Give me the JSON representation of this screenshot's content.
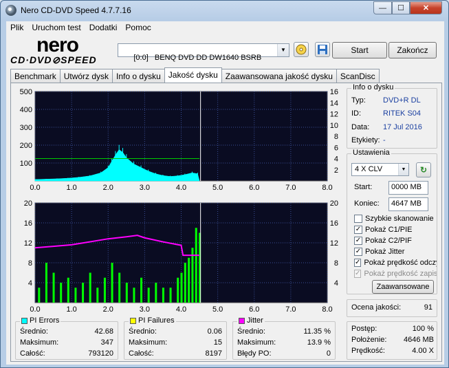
{
  "window": {
    "title": "Nero CD-DVD Speed 4.7.7.16",
    "min": "—",
    "max": "☐",
    "close": "✕"
  },
  "menu": [
    "Plik",
    "Uruchom test",
    "Dodatki",
    "Pomoc"
  ],
  "logo": {
    "top": "nero",
    "bottom": "CD·DVD⊘SPEED"
  },
  "toolbar": {
    "drive": "[0:0]   BENQ DVD DD DW1640 BSRB",
    "start": "Start",
    "exit": "Zakończ"
  },
  "tabs": [
    "Benchmark",
    "Utwórz dysk",
    "Info o dysku",
    "Jakość dysku",
    "Zaawansowana jakość dysku",
    "ScanDisc"
  ],
  "active_tab": 3,
  "disc_info": {
    "title": "Info o dysku",
    "type_label": "Typ:",
    "type": "DVD+R DL",
    "id_label": "ID:",
    "id": "RITEK S04",
    "date_label": "Data:",
    "date": "17 Jul 2016",
    "label_label": "Etykiety:",
    "label": "-"
  },
  "settings": {
    "title": "Ustawienia",
    "speed": "4 X CLV",
    "start_label": "Start:",
    "start": "0000 MB",
    "end_label": "Koniec:",
    "end": "4647 MB",
    "quick": "Szybkie skanowanie",
    "c1": "Pokaż C1/PIE",
    "c2": "Pokaż C2/PIF",
    "jitter": "Pokaż Jitter",
    "read": "Pokaż prędkość odczytu",
    "write": "Pokaż prędkość zapisu",
    "advanced": "Zaawansowane"
  },
  "quality": {
    "label": "Ocena jakości:",
    "value": "91"
  },
  "progress": {
    "progress_label": "Postęp:",
    "progress": "100 %",
    "position_label": "Położenie:",
    "position": "4646 MB",
    "speed_label": "Prędkość:",
    "speed": "4.00 X"
  },
  "pi_errors": {
    "title": "PI Errors",
    "color": "#00ffff",
    "avg_label": "Średnio:",
    "avg": "42.68",
    "max_label": "Maksimum:",
    "max": "347",
    "total_label": "Całość:",
    "total": "793120"
  },
  "pi_failures": {
    "title": "PI Failures",
    "color": "#ffff00",
    "avg_label": "Średnio:",
    "avg": "0.06",
    "max_label": "Maksimum:",
    "max": "15",
    "total_label": "Całość:",
    "total": "8197"
  },
  "jitter": {
    "title": "Jitter",
    "color": "#ff00ff",
    "avg_label": "Średnio:",
    "avg": "11.35 %",
    "max_label": "Maksimum:",
    "max": "13.9 %",
    "po_label": "Błędy PO:",
    "po": "0"
  },
  "chart_data": [
    {
      "type": "area",
      "name": "PI Errors chart",
      "xlim": [
        0,
        8
      ],
      "ylim": [
        0,
        500
      ],
      "y2lim": [
        0,
        16
      ],
      "xticks": [
        "0.0",
        "1.0",
        "2.0",
        "3.0",
        "4.0",
        "5.0",
        "6.0",
        "7.0",
        "8.0"
      ],
      "yticks": [
        "100",
        "200",
        "300",
        "400",
        "500"
      ],
      "y2ticks": [
        "2",
        "4",
        "6",
        "8",
        "10",
        "12",
        "14",
        "16"
      ],
      "series": [
        {
          "name": "PI Errors",
          "color": "#00ffff",
          "x": [
            0.0,
            0.3,
            0.6,
            0.9,
            1.2,
            1.5,
            1.8,
            2.0,
            2.1,
            2.2,
            2.3,
            2.4,
            2.5,
            2.7,
            2.9,
            3.1,
            3.3,
            3.5,
            3.7,
            3.9,
            4.1,
            4.3,
            4.45,
            4.5
          ],
          "y": [
            8,
            10,
            12,
            15,
            20,
            28,
            45,
            75,
            110,
            145,
            175,
            160,
            130,
            95,
            75,
            55,
            40,
            30,
            25,
            28,
            35,
            45,
            40,
            0
          ]
        },
        {
          "name": "Read speed",
          "color": "#00cc00",
          "x": [
            0.0,
            4.5
          ],
          "y": [
            4,
            4
          ]
        }
      ]
    },
    {
      "type": "bar",
      "name": "PI Failures chart",
      "xlim": [
        0,
        8
      ],
      "ylim": [
        0,
        20
      ],
      "y2lim": [
        0,
        20
      ],
      "xticks": [
        "0.0",
        "1.0",
        "2.0",
        "3.0",
        "4.0",
        "5.0",
        "6.0",
        "7.0",
        "8.0"
      ],
      "yticks": [
        "4",
        "8",
        "12",
        "16",
        "20"
      ],
      "y2ticks": [
        "4",
        "8",
        "12",
        "16",
        "20"
      ],
      "series": [
        {
          "name": "PI Failures",
          "color": "#00ff00",
          "x": [
            0.1,
            0.3,
            0.5,
            0.7,
            0.9,
            1.1,
            1.3,
            1.5,
            1.7,
            1.9,
            2.1,
            2.3,
            2.5,
            2.7,
            2.9,
            3.1,
            3.3,
            3.5,
            3.7,
            3.9,
            4.0,
            4.1,
            4.2,
            4.3,
            4.4,
            4.5
          ],
          "y": [
            3,
            8,
            6,
            4,
            5,
            3,
            4,
            6,
            3,
            5,
            8,
            6,
            4,
            3,
            5,
            3,
            4,
            3,
            3,
            5,
            6,
            8,
            9,
            11,
            15,
            14
          ]
        },
        {
          "name": "Jitter",
          "color": "#ff00ff",
          "x": [
            0.0,
            0.5,
            1.0,
            1.5,
            2.0,
            2.5,
            2.8,
            3.0,
            3.5,
            4.0,
            4.05,
            4.5
          ],
          "y": [
            11.0,
            11.3,
            11.6,
            12.2,
            12.8,
            13.2,
            13.5,
            13.0,
            12.2,
            11.5,
            9.5,
            9.5
          ]
        }
      ]
    }
  ]
}
